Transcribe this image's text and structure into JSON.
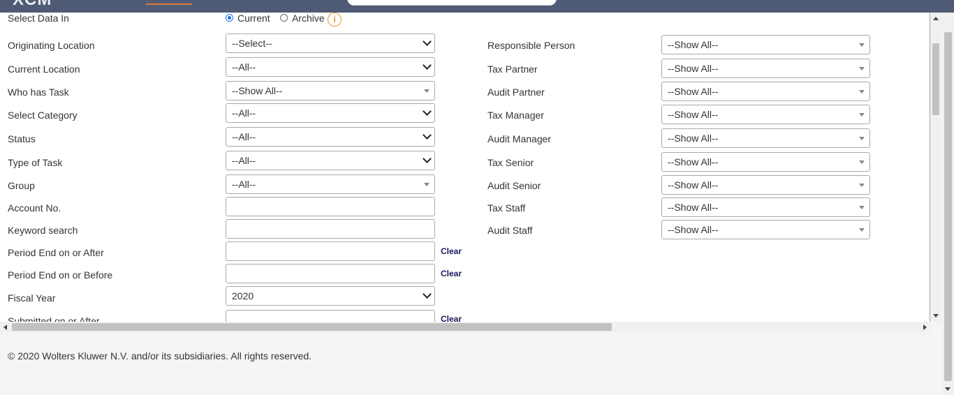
{
  "header": {
    "logo_text": "XCM"
  },
  "select_data_in": {
    "label": "Select Data In",
    "options": [
      "Current",
      "Archive"
    ],
    "selected": "Current"
  },
  "left_fields": [
    {
      "label": "Originating Location",
      "value": "--Select--",
      "type": "select"
    },
    {
      "label": "Current Location",
      "value": "--All--",
      "type": "select"
    },
    {
      "label": "Who has Task",
      "value": "--Show All--",
      "type": "combo"
    },
    {
      "label": "Select Category",
      "value": "--All--",
      "type": "select"
    },
    {
      "label": "Status",
      "value": "--All--",
      "type": "select"
    },
    {
      "label": "Type of Task",
      "value": "--All--",
      "type": "select"
    },
    {
      "label": "Group",
      "value": "--All--",
      "type": "combo"
    },
    {
      "label": "Account No.",
      "value": "",
      "type": "text"
    },
    {
      "label": "Keyword search",
      "value": "",
      "type": "text"
    },
    {
      "label": "Period End on or After",
      "value": "",
      "type": "date"
    },
    {
      "label": "Period End on or Before",
      "value": "",
      "type": "date"
    },
    {
      "label": "Fiscal Year",
      "value": "2020",
      "type": "select"
    },
    {
      "label": "Submitted on or After",
      "value": "",
      "type": "date"
    }
  ],
  "right_fields": [
    {
      "label": "Responsible Person",
      "value": "--Show All--"
    },
    {
      "label": "Tax Partner",
      "value": "--Show All--"
    },
    {
      "label": "Audit Partner",
      "value": "--Show All--"
    },
    {
      "label": "Tax Manager",
      "value": "--Show All--"
    },
    {
      "label": "Audit Manager",
      "value": "--Show All--"
    },
    {
      "label": "Tax Senior",
      "value": "--Show All--"
    },
    {
      "label": "Audit Senior",
      "value": "--Show All--"
    },
    {
      "label": "Tax Staff",
      "value": "--Show All--"
    },
    {
      "label": "Audit Staff",
      "value": "--Show All--"
    }
  ],
  "clear_label": "Clear",
  "info_icon_glyph": "i",
  "footer": {
    "copyright": "© 2020 Wolters Kluwer N.V. and/or its subsidiaries. All rights reserved."
  },
  "colors": {
    "header_bg": "#4f5b74",
    "accent": "#e07a3a",
    "link": "#1a1a5e",
    "info": "#e69a2e"
  }
}
